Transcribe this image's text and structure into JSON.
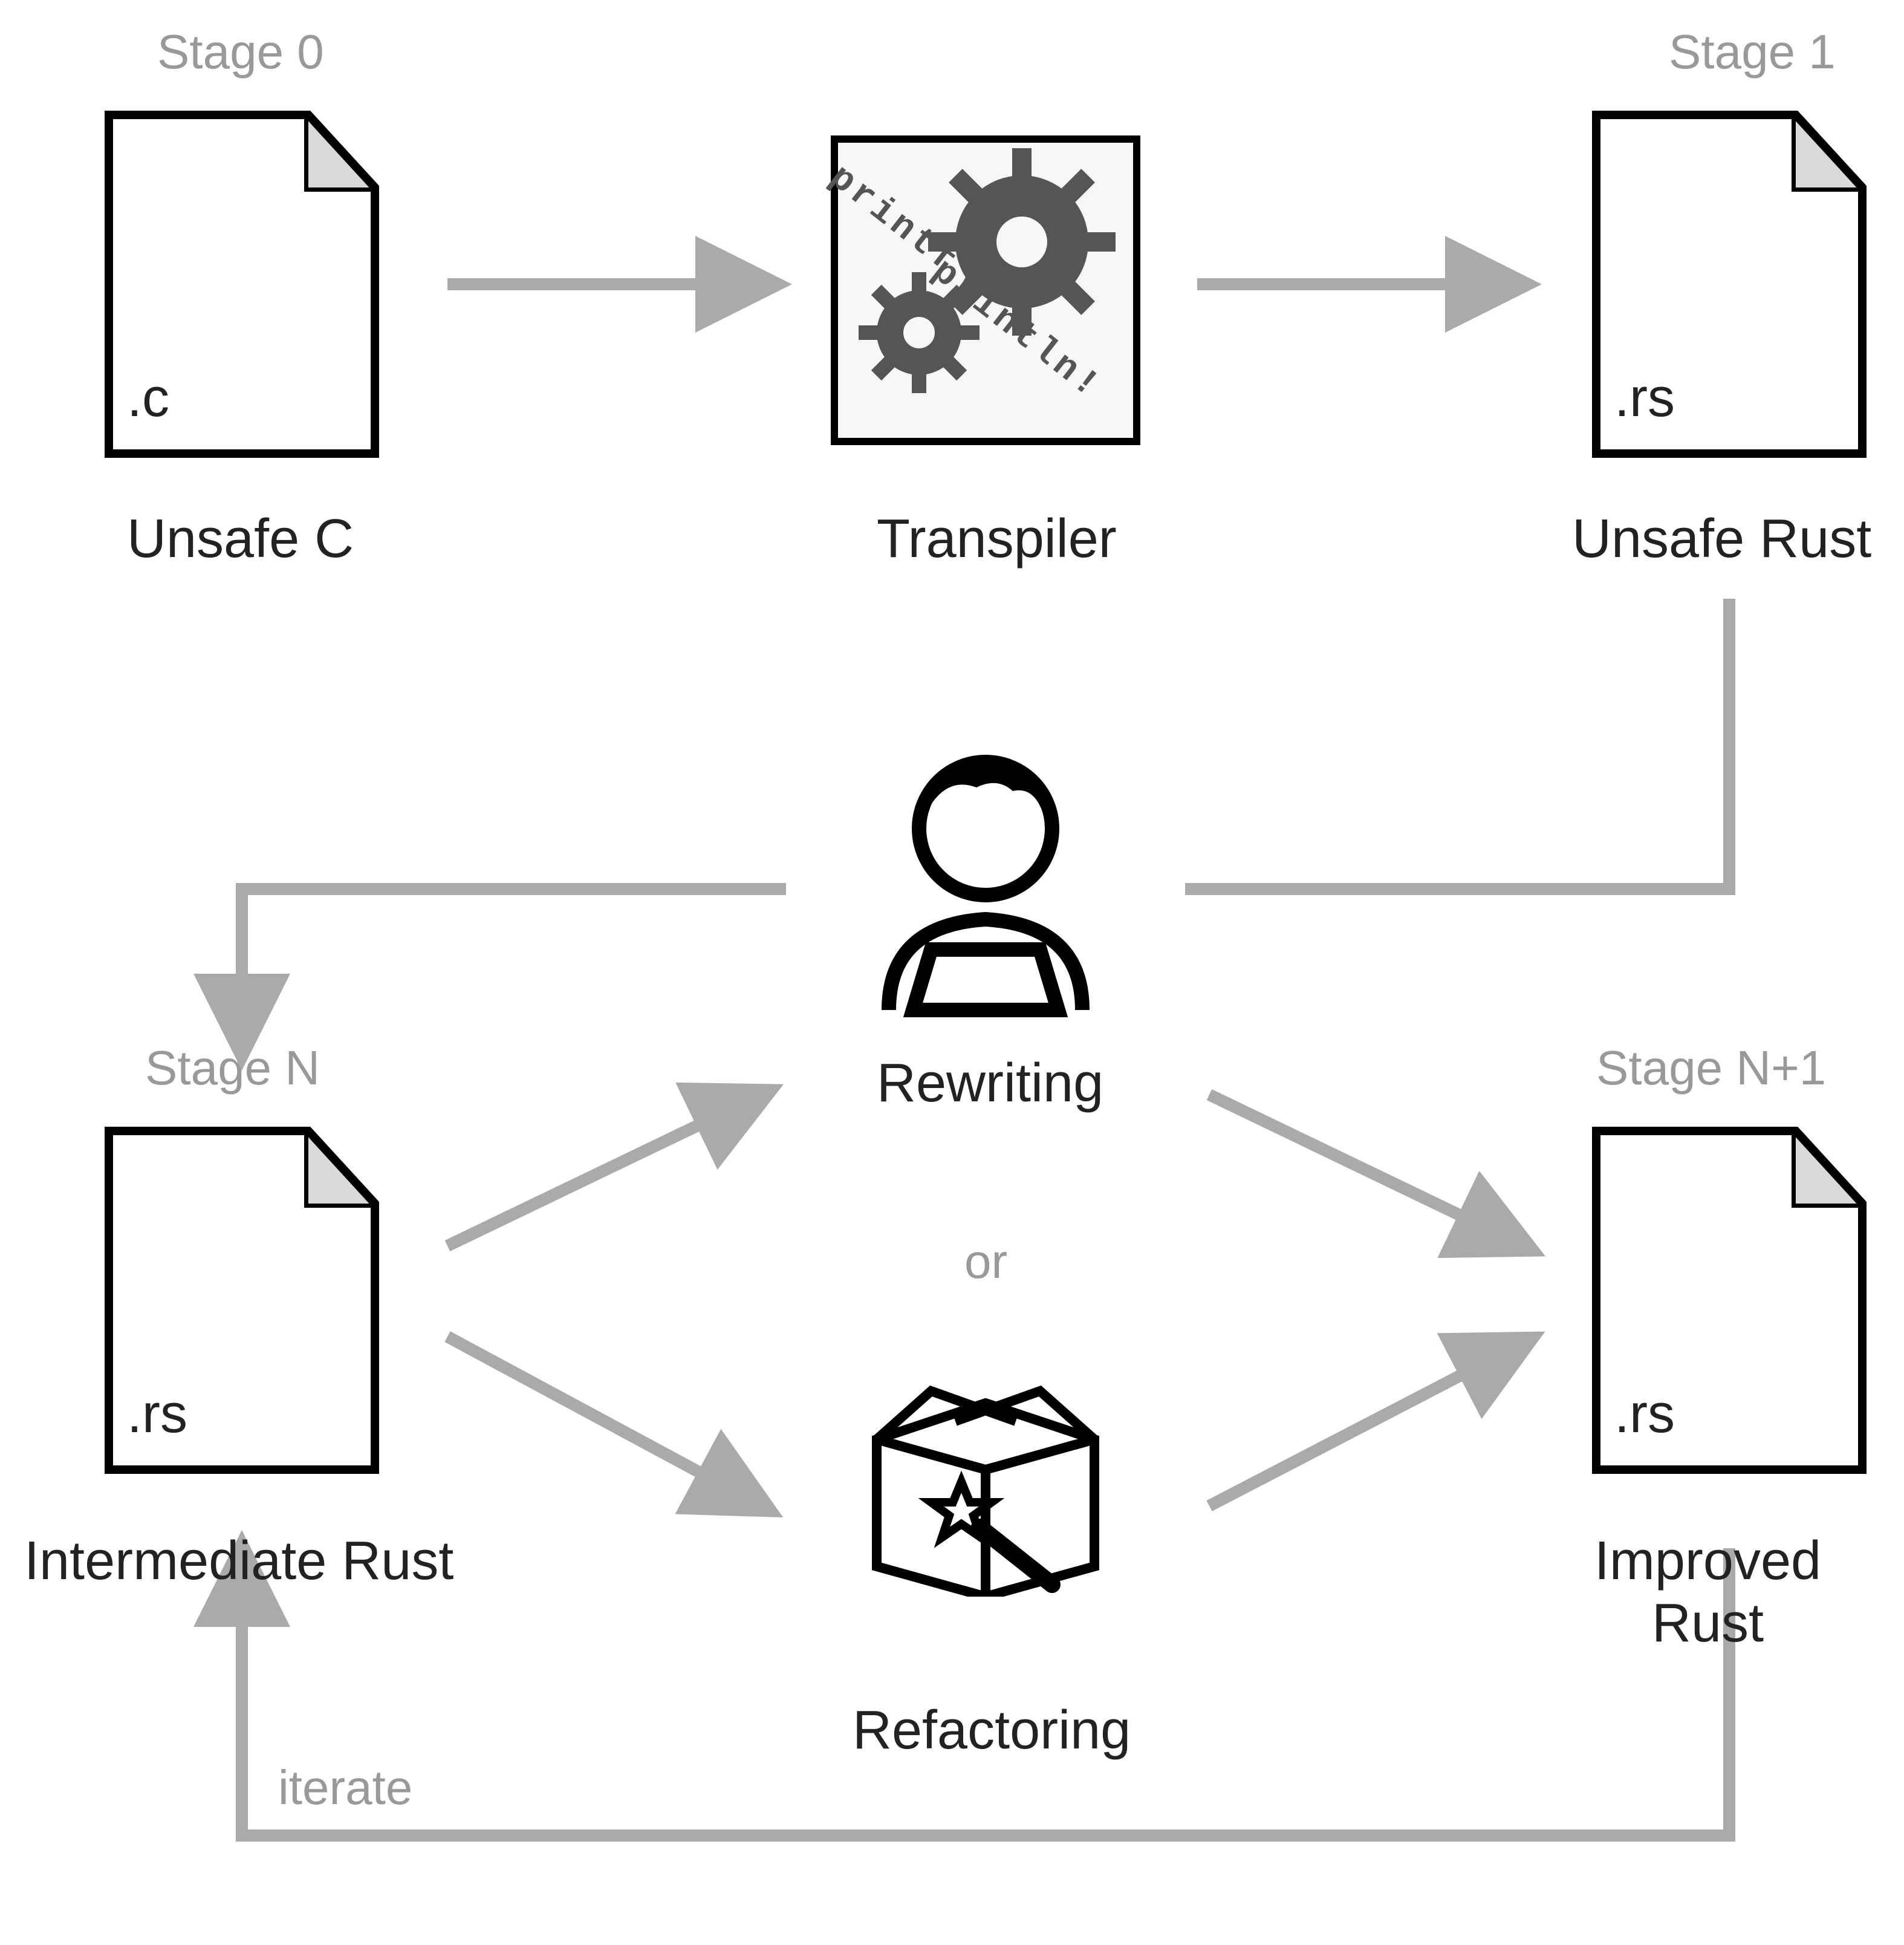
{
  "stages": {
    "s0": "Stage 0",
    "s1": "Stage 1",
    "sn": "Stage N",
    "sn1": "Stage N+1"
  },
  "nodes": {
    "unsafe_c": "Unsafe C",
    "transpiler": "Transpiler",
    "unsafe_rust": "Unsafe Rust",
    "rewriting": "Rewriting",
    "refactoring": "Refactoring",
    "intermediate_rust": "Intermediate Rust",
    "improved_rust": "Improved Rust"
  },
  "file_ext": {
    "c": ".c",
    "rs": ".rs"
  },
  "transpiler_text": {
    "from": "printf",
    "to": "println!"
  },
  "misc": {
    "or": "or",
    "iterate": "iterate"
  }
}
